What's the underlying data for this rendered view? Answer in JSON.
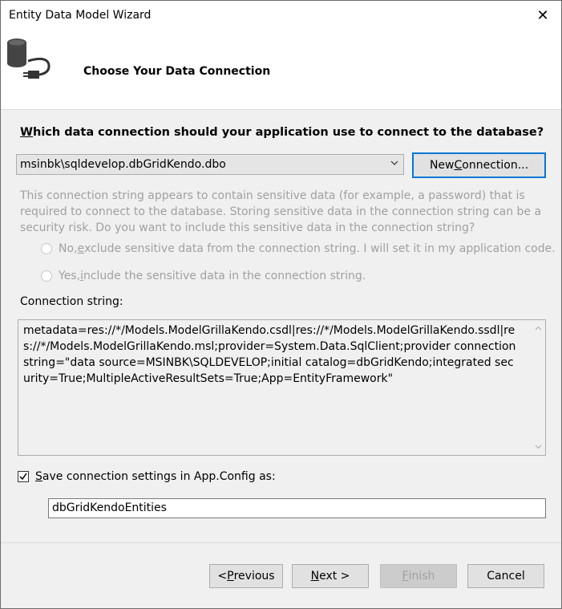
{
  "window": {
    "title": "Entity Data Model Wizard",
    "close_glyph": "✕"
  },
  "header": {
    "title": "Choose Your Data Connection",
    "icon": "database-plug-icon"
  },
  "question": {
    "prefix": "W",
    "rest": "hich data connection should your application use to connect to the database?"
  },
  "connection_select": {
    "value": "msinbk\\sqldevelop.dbGridKendo.dbo"
  },
  "new_connection": {
    "before": "New ",
    "accel": "C",
    "after": "onnection..."
  },
  "sensitive": {
    "text": "This connection string appears to contain sensitive data (for example, a password) that is required to connect to the database. Storing sensitive data in the connection string can be a security risk. Do you want to include this sensitive data in the connection string?",
    "option_no": {
      "before": "No, ",
      "accel": "e",
      "after": "xclude sensitive data from the connection string. I will set it in my application code."
    },
    "option_yes": {
      "before": "Yes, ",
      "accel": "i",
      "after": "nclude the sensitive data in the connection string."
    }
  },
  "connection_string": {
    "label": "Connection string:",
    "value": "metadata=res://*/Models.ModelGrillaKendo.csdl|res://*/Models.ModelGrillaKendo.ssdl|res://*/Models.ModelGrillaKendo.msl;provider=System.Data.SqlClient;provider connection string=\"data source=MSINBK\\SQLDEVELOP;initial catalog=dbGridKendo;integrated security=True;MultipleActiveResultSets=True;App=EntityFramework\""
  },
  "save_settings": {
    "checked": true,
    "accel": "S",
    "after": "ave connection settings in App.Config as:",
    "name": "dbGridKendoEntities"
  },
  "buttons": {
    "previous": {
      "before": "< ",
      "accel": "P",
      "after": "revious"
    },
    "next": {
      "accel": "N",
      "after": "ext >"
    },
    "finish": {
      "accel": "F",
      "after": "inish"
    },
    "cancel": "Cancel"
  },
  "colors": {
    "accent": "#0078d7",
    "disabled_text": "#a0a0a0",
    "header_bg": "#ffffff",
    "body_bg": "#f0f0f0"
  }
}
